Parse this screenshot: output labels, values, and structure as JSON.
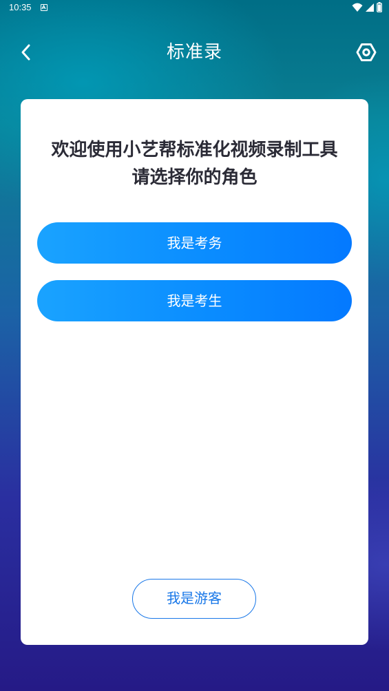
{
  "status_bar": {
    "time": "10:35",
    "icons": [
      "notification-a-icon",
      "wifi-icon",
      "signal-icon",
      "battery-icon"
    ]
  },
  "header": {
    "title": "标准录",
    "back_icon": "chevron-left-icon",
    "settings_icon": "settings-hex-icon"
  },
  "card": {
    "welcome_line1": "欢迎使用小艺帮标准化视频录制工具",
    "welcome_line2": "请选择你的角色",
    "role_buttons": [
      {
        "label": "我是考务"
      },
      {
        "label": "我是考生"
      }
    ],
    "guest_button": "我是游客"
  },
  "colors": {
    "primary_blue": "#0a8cff",
    "guest_border": "#1877e8",
    "title_text": "#2b2b36"
  }
}
